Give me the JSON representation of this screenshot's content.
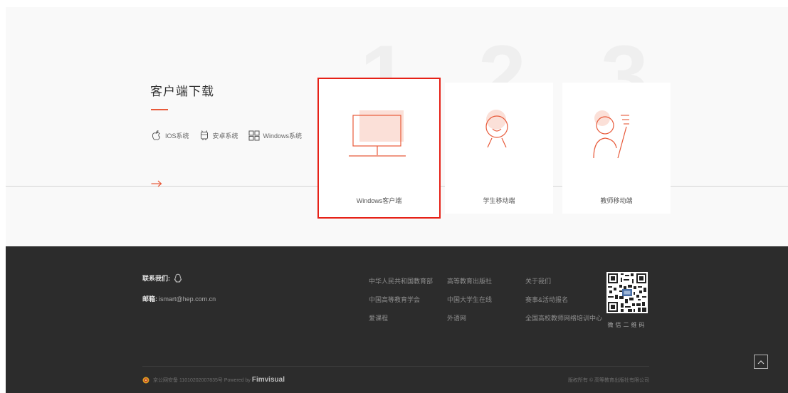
{
  "download": {
    "title": "客户端下载",
    "numbers": [
      "1",
      "2",
      "3"
    ],
    "os": [
      {
        "icon": "apple-icon",
        "label": "IOS系统"
      },
      {
        "icon": "android-icon",
        "label": "安卓系统"
      },
      {
        "icon": "windows-icon",
        "label": "Windows系统"
      }
    ],
    "cards": [
      {
        "icon": "monitor-icon",
        "label": "Windows客户端",
        "active": true
      },
      {
        "icon": "student-icon",
        "label": "学生移动端",
        "active": false
      },
      {
        "icon": "teacher-icon",
        "label": "教师移动端",
        "active": false
      }
    ]
  },
  "footer": {
    "contact": {
      "label": "联系我们:",
      "email_label": "邮箱:",
      "email": "ismart@hep.com.cn"
    },
    "link_columns": [
      [
        "中华人民共和国教育部",
        "中国高等教育学会",
        "爱课程"
      ],
      [
        "高等教育出版社",
        "中国大学生在线",
        "外语网"
      ],
      [
        "关于我们",
        "赛事&活动报名",
        "全国高校教师网络培训中心"
      ]
    ],
    "qr_caption": "微信二维码",
    "icp": "京公网安备 11010202007835号 Powered by",
    "brand": "Fimvisual",
    "copyright": "版权所有 © 高等教育出版社有限公司"
  },
  "colors": {
    "accent": "#e85a3a",
    "highlight_border": "#e62117",
    "footer_bg": "#2c2c2c",
    "section_bg": "#f9f9f9"
  }
}
